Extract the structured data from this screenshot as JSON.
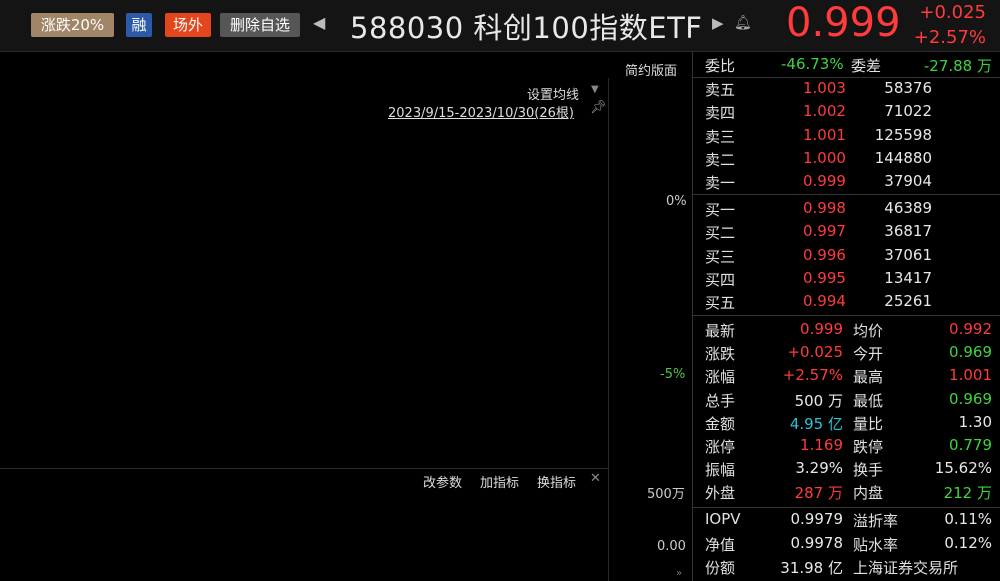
{
  "header": {
    "tag_limit": "涨跌20%",
    "tag_margin": "融",
    "tag_offexchange": "场外",
    "tag_remove": "删除自选",
    "nav_prev": "◀",
    "title": "588030 科创100指数ETF",
    "nav_next": "▶",
    "price": "0.999",
    "change_abs": "+0.025",
    "change_pct": "+2.57%"
  },
  "chart": {
    "simple_version": "简约版面",
    "set_ma": "设置均线",
    "date_range": "2023/9/15-2023/10/30(26根)",
    "axis_pct_0": "0%",
    "axis_pct_neg5": "-5%",
    "btn_change_param": "改参数",
    "btn_add_indicator": "加指标",
    "btn_switch_indicator": "换指标",
    "vol_axis_top": "500万",
    "vol_axis_bottom": "0.00"
  },
  "order_ratio": {
    "label_ratio": "委比",
    "ratio": "-46.73%",
    "label_diff": "委差",
    "diff": "-27.88 万"
  },
  "asks": [
    {
      "label": "卖五",
      "price": "1.003",
      "vol": "58376"
    },
    {
      "label": "卖四",
      "price": "1.002",
      "vol": "71022"
    },
    {
      "label": "卖三",
      "price": "1.001",
      "vol": "125598"
    },
    {
      "label": "卖二",
      "price": "1.000",
      "vol": "144880"
    },
    {
      "label": "卖一",
      "price": "0.999",
      "vol": "37904"
    }
  ],
  "bids": [
    {
      "label": "买一",
      "price": "0.998",
      "vol": "46389"
    },
    {
      "label": "买二",
      "price": "0.997",
      "vol": "36817"
    },
    {
      "label": "买三",
      "price": "0.996",
      "vol": "37061"
    },
    {
      "label": "买四",
      "price": "0.995",
      "vol": "13417"
    },
    {
      "label": "买五",
      "price": "0.994",
      "vol": "25261"
    }
  ],
  "stats": [
    {
      "l1": "最新",
      "v1": "0.999",
      "c1": "red",
      "l2": "均价",
      "v2": "0.992",
      "c2": "red"
    },
    {
      "l1": "涨跌",
      "v1": "+0.025",
      "c1": "red",
      "l2": "今开",
      "v2": "0.969",
      "c2": "green"
    },
    {
      "l1": "涨幅",
      "v1": "+2.57%",
      "c1": "red",
      "l2": "最高",
      "v2": "1.001",
      "c2": "red"
    },
    {
      "l1": "总手",
      "v1": "500 万",
      "c1": "white",
      "l2": "最低",
      "v2": "0.969",
      "c2": "green"
    },
    {
      "l1": "金额",
      "v1": "4.95 亿",
      "c1": "cyan",
      "l2": "量比",
      "v2": "1.30",
      "c2": "white"
    },
    {
      "l1": "涨停",
      "v1": "1.169",
      "c1": "red",
      "l2": "跌停",
      "v2": "0.779",
      "c2": "green"
    },
    {
      "l1": "振幅",
      "v1": "3.29%",
      "c1": "white",
      "l2": "换手",
      "v2": "15.62%",
      "c2": "white"
    },
    {
      "l1": "外盘",
      "v1": "287 万",
      "c1": "red",
      "l2": "内盘",
      "v2": "212 万",
      "c2": "green"
    }
  ],
  "fund": [
    {
      "l1": "IOPV",
      "v1": "0.9979",
      "l2": "溢折率",
      "v2": "0.11%"
    },
    {
      "l1": "净值",
      "v1": "0.9978",
      "l2": "贴水率",
      "v2": "0.12%"
    },
    {
      "l1": "份额",
      "v1": "31.98 亿",
      "l2": "上海证券交易所",
      "v2": ""
    }
  ],
  "colors": {
    "up": "#ff3b3b",
    "down": "#3fd43f",
    "amount": "#28c5d6"
  }
}
